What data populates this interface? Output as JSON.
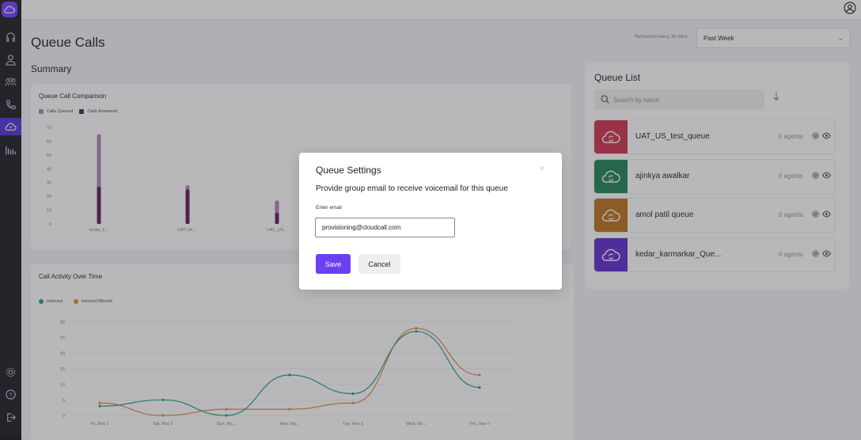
{
  "page": {
    "title": "Queue Calls",
    "summary_title": "Summary",
    "refresh_note": "Refreshed every 30 mins",
    "range_value": "Past Week"
  },
  "colors": {
    "accent": "#6d3ff2",
    "sidebar": "#2b2b33",
    "calls_queued": "#b58db9",
    "calls_answered": "#6b2a64",
    "inbound": "#2ea58c",
    "inbound_missed": "#e0934a"
  },
  "sidebar": {
    "items": [
      "headset-icon",
      "person-icon",
      "group-icon",
      "phone-icon",
      "cloud-queue-icon",
      "reports-icon",
      "settings-icon",
      "help-icon",
      "logout-icon"
    ],
    "active": "cloud-queue-icon"
  },
  "comparison_card": {
    "title": "Queue Call Comparison",
    "legend": [
      "Calls Queued",
      "Calls Answered"
    ]
  },
  "activity_card": {
    "title": "Call Activity Over Time",
    "legend": [
      "Inbound",
      "Inbound Missed"
    ]
  },
  "chart_data": [
    {
      "type": "bar",
      "title": "Queue Call Comparison",
      "categories": [
        "kedar_k...",
        "UAT UK ...",
        "UAT_US..."
      ],
      "yticks": [
        0,
        10,
        20,
        30,
        40,
        50,
        60,
        70
      ],
      "ylim": [
        0,
        70
      ],
      "series": [
        {
          "name": "Calls Queued",
          "values": [
            65,
            28,
            17
          ],
          "color": "#b58db9"
        },
        {
          "name": "Calls Answered",
          "values": [
            27,
            25,
            8
          ],
          "color": "#6b2a64"
        }
      ],
      "legend": "top-left"
    },
    {
      "type": "line",
      "title": "Call Activity Over Time",
      "categories": [
        "Fri, Nov 1",
        "Sat, Nov 2",
        "Sun, No...",
        "Mon, No...",
        "Tue, Nov 5",
        "Wed, No...",
        "Thu, Nov 7"
      ],
      "yticks": [
        0,
        5,
        10,
        15,
        20,
        25,
        30
      ],
      "ylim": [
        0,
        30
      ],
      "series": [
        {
          "name": "Inbound",
          "values": [
            3,
            5,
            0,
            13,
            7,
            27,
            9
          ],
          "color": "#2ea58c"
        },
        {
          "name": "Inbound Missed",
          "values": [
            4,
            0,
            2,
            2,
            4,
            28,
            13
          ],
          "color": "#e0934a"
        }
      ],
      "legend": "top-left",
      "grid": true
    }
  ],
  "queue_list": {
    "title": "Queue List",
    "search_placeholder": "Search by name",
    "items": [
      {
        "name": "UAT_US_test_queue",
        "agents": "0 agents",
        "color": "#d1415a"
      },
      {
        "name": "ajinkya awalkar",
        "agents": "0 agents",
        "color": "#2f8a63"
      },
      {
        "name": "amol patil queue",
        "agents": "0 agents",
        "color": "#c07a2c"
      },
      {
        "name": "kedar_karmarkar_Que...",
        "agents": "0 agents",
        "color": "#6b3ad1"
      }
    ]
  },
  "modal": {
    "title": "Queue Settings",
    "close": "×",
    "description": "Provide group email to receive voicemail for this queue",
    "email_label": "Enter email",
    "email_value": "provisioning@cloudcall.com",
    "save_label": "Save",
    "cancel_label": "Cancel"
  }
}
